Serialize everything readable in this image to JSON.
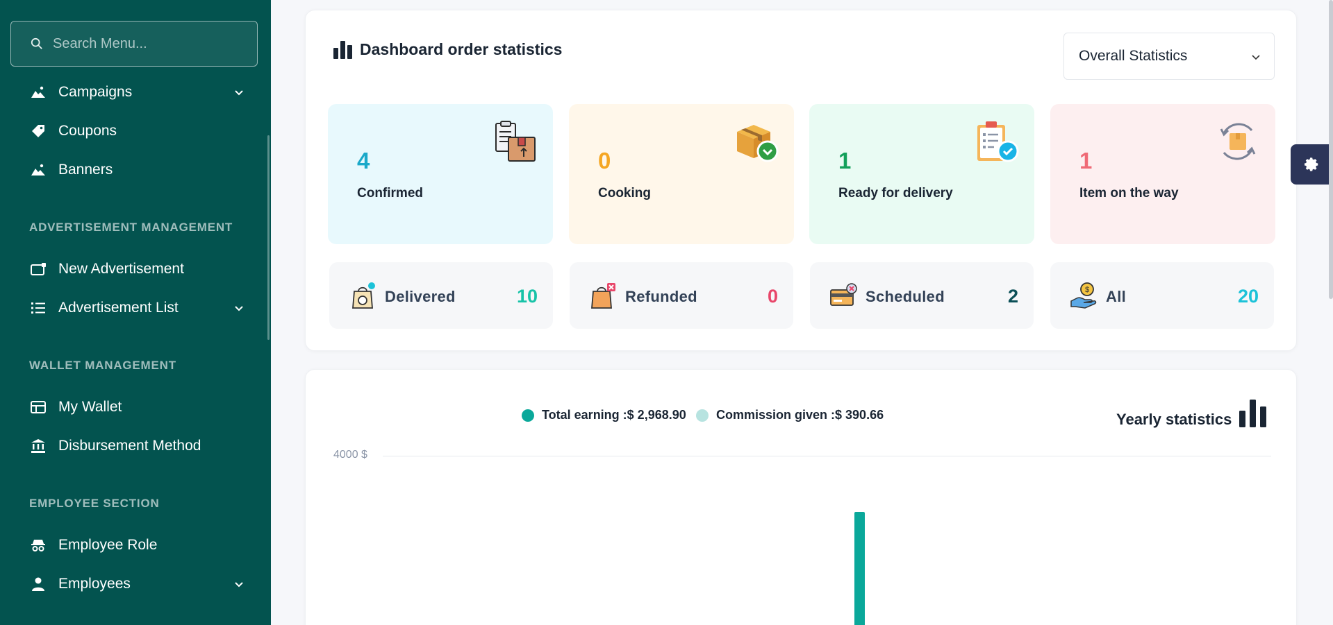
{
  "sidebar": {
    "search_placeholder": "Search Menu...",
    "items": [
      {
        "label": "Campaigns",
        "icon": "image-icon",
        "has_chevron": true
      },
      {
        "label": "Coupons",
        "icon": "tag-icon"
      },
      {
        "label": "Banners",
        "icon": "image-icon"
      }
    ],
    "sections": [
      {
        "title": "ADVERTISEMENT MANAGEMENT",
        "items": [
          {
            "label": "New Advertisement",
            "icon": "tv-icon"
          },
          {
            "label": "Advertisement List",
            "icon": "list-icon",
            "has_chevron": true
          }
        ]
      },
      {
        "title": "WALLET MANAGEMENT",
        "items": [
          {
            "label": "My Wallet",
            "icon": "wallet-icon"
          },
          {
            "label": "Disbursement Method",
            "icon": "bank-icon"
          }
        ]
      },
      {
        "title": "EMPLOYEE SECTION",
        "items": [
          {
            "label": "Employee Role",
            "icon": "spy-icon"
          },
          {
            "label": "Employees",
            "icon": "user-icon",
            "has_chevron": true
          }
        ]
      }
    ]
  },
  "dashboard": {
    "title": "Dashboard order statistics",
    "filter_selected": "Overall Statistics",
    "big_cards": [
      {
        "value": "4",
        "label": "Confirmed",
        "color": "#1ba9c9",
        "bg": "#e8f9fd"
      },
      {
        "value": "0",
        "label": "Cooking",
        "color": "#f5a623",
        "bg": "#fff7ea"
      },
      {
        "value": "1",
        "label": "Ready for delivery",
        "color": "#13a05a",
        "bg": "#e9fbf3"
      },
      {
        "value": "1",
        "label": "Item on the way",
        "color": "#ef6a76",
        "bg": "#fdeff0"
      }
    ],
    "small_cards": [
      {
        "label": "Delivered",
        "value": "10",
        "color": "#17c3a8"
      },
      {
        "label": "Refunded",
        "value": "0",
        "color": "#e8466a"
      },
      {
        "label": "Scheduled",
        "value": "2",
        "color": "#0b4f57"
      },
      {
        "label": "All",
        "value": "20",
        "color": "#1cc2d8"
      }
    ]
  },
  "chart": {
    "legend_total": "Total earning :$ 2,968.90",
    "legend_commission": "Commission given :$ 390.66",
    "yearly_label": "Yearly statistics",
    "y_tick": "4000 $",
    "colors": {
      "earning": "#0aa89a",
      "commission": "#b7e3e0"
    }
  },
  "chart_data": {
    "type": "bar",
    "ylim": [
      0,
      4000
    ],
    "series": [
      {
        "name": "Total earning",
        "values": [
          2968.9
        ]
      },
      {
        "name": "Commission given",
        "values": [
          390.66
        ]
      }
    ]
  }
}
